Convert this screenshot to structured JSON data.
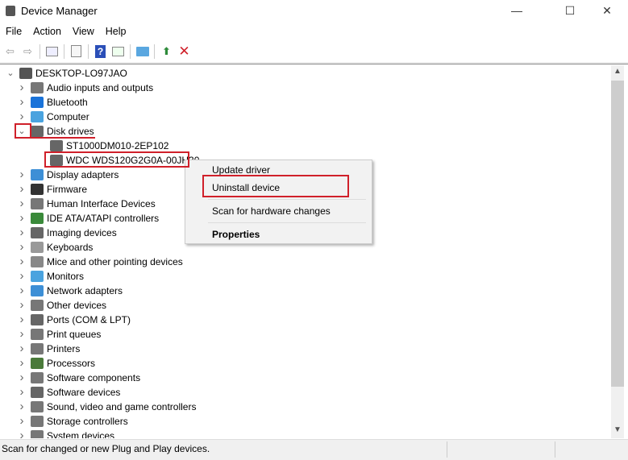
{
  "window": {
    "title": "Device Manager",
    "controls": {
      "minimize": "—",
      "maximize": "☐",
      "close": "✕"
    }
  },
  "menu": [
    "File",
    "Action",
    "View",
    "Help"
  ],
  "toolbar": [
    "back-icon",
    "forward-icon",
    "show-hide-console-tree-icon",
    "properties-icon",
    "help-icon",
    "action-pane-icon",
    "scan-hardware-icon",
    "update-driver-icon",
    "uninstall-icon"
  ],
  "tree": {
    "root": "DESKTOP-LO97JAO",
    "categories": [
      {
        "label": "Audio inputs and outputs",
        "icon": "speaker-icon",
        "color": "#777"
      },
      {
        "label": "Bluetooth",
        "icon": "bluetooth-icon",
        "color": "#1a73d9"
      },
      {
        "label": "Computer",
        "icon": "computer-icon",
        "color": "#4aa3df"
      },
      {
        "label": "Disk drives",
        "icon": "disk-drive-icon",
        "color": "#666",
        "expanded": true,
        "children": [
          "ST1000DM010-2EP102",
          "WDC WDS120G2G0A-00JH30"
        ]
      },
      {
        "label": "Display adapters",
        "icon": "display-adapter-icon",
        "color": "#3d8fd6"
      },
      {
        "label": "Firmware",
        "icon": "firmware-icon",
        "color": "#333"
      },
      {
        "label": "Human Interface Devices",
        "icon": "hid-icon",
        "color": "#777"
      },
      {
        "label": "IDE ATA/ATAPI controllers",
        "icon": "ide-controller-icon",
        "color": "#3a8a3a"
      },
      {
        "label": "Imaging devices",
        "icon": "camera-icon",
        "color": "#666"
      },
      {
        "label": "Keyboards",
        "icon": "keyboard-icon",
        "color": "#999"
      },
      {
        "label": "Mice and other pointing devices",
        "icon": "mouse-icon",
        "color": "#888"
      },
      {
        "label": "Monitors",
        "icon": "monitor-icon",
        "color": "#4aa3df"
      },
      {
        "label": "Network adapters",
        "icon": "network-icon",
        "color": "#3d8fd6"
      },
      {
        "label": "Other devices",
        "icon": "other-devices-icon",
        "color": "#777"
      },
      {
        "label": "Ports (COM & LPT)",
        "icon": "port-icon",
        "color": "#666"
      },
      {
        "label": "Print queues",
        "icon": "print-queue-icon",
        "color": "#777"
      },
      {
        "label": "Printers",
        "icon": "printer-icon",
        "color": "#777"
      },
      {
        "label": "Processors",
        "icon": "processor-icon",
        "color": "#4a7a3a"
      },
      {
        "label": "Software components",
        "icon": "software-component-icon",
        "color": "#777"
      },
      {
        "label": "Software devices",
        "icon": "software-device-icon",
        "color": "#666"
      },
      {
        "label": "Sound, video and game controllers",
        "icon": "sound-icon",
        "color": "#777"
      },
      {
        "label": "Storage controllers",
        "icon": "storage-controller-icon",
        "color": "#777"
      },
      {
        "label": "System devices",
        "icon": "system-devices-icon",
        "color": "#777"
      }
    ]
  },
  "context_menu": {
    "items": [
      "Update driver",
      "Uninstall device",
      "Scan for hardware changes",
      "Properties"
    ],
    "highlighted": "Uninstall device"
  },
  "status": "Scan for changed or new Plug and Play devices.",
  "colors": {
    "highlight_box": "#d0202a",
    "uninstall_x": "#d0202a"
  }
}
